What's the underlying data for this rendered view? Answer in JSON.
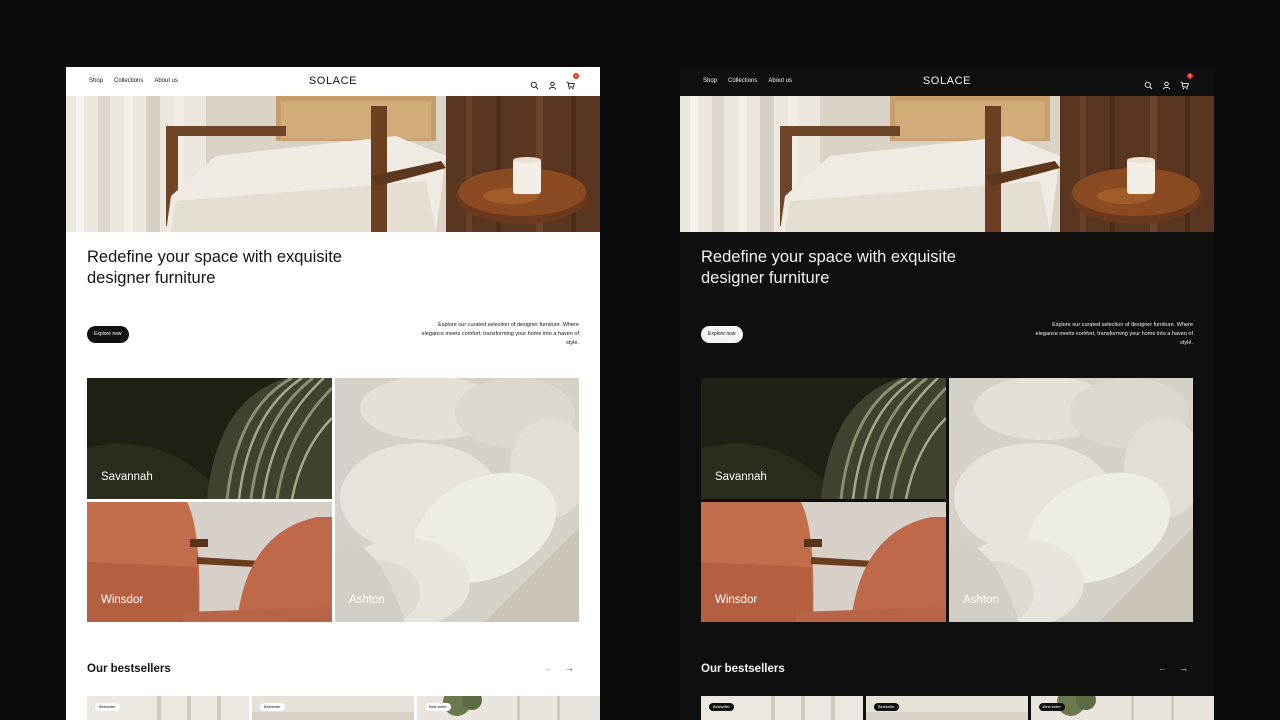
{
  "nav": {
    "links": [
      "Shop",
      "Collections",
      "About us"
    ],
    "brand": "SOLACE",
    "icons": [
      "search-icon",
      "user-icon",
      "cart-icon"
    ],
    "cart_count": "0"
  },
  "hero": {
    "headline": "Redefine your space with exquisite designer furniture",
    "cta_label": "Explore now",
    "intro": "Explore our curated selection of designer furniture. Where elegance meets comfort, transforming your home into a haven of style."
  },
  "collections": [
    {
      "name": "Savannah"
    },
    {
      "name": "Winsdor"
    },
    {
      "name": "Ashton"
    }
  ],
  "bestsellers": {
    "title": "Our bestsellers",
    "prev_icon": "arrow-left-icon",
    "next_icon": "arrow-right-icon",
    "badges": [
      "Bestseller",
      "Bestseller",
      "Best seller"
    ]
  },
  "themes": [
    "light",
    "dark"
  ],
  "colors": {
    "background": "#0b0b0b",
    "light_surface": "#ffffff",
    "dark_surface": "#0f0f0f",
    "badge_red": "#e2321e"
  }
}
